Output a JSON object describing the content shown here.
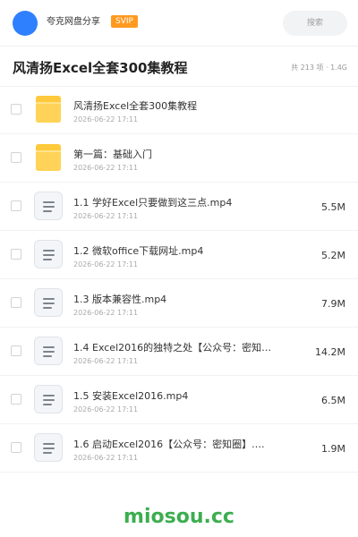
{
  "header": {
    "share_title": "夸克网盘分享",
    "badge": "SVIP",
    "search_placeholder": "搜索"
  },
  "folder": {
    "title": "风清扬Excel全套300集教程",
    "meta": "共 213 项 · 1.4G"
  },
  "colors": {
    "accent_blue": "#2f80ff",
    "svip_orange": "#ff9a1f",
    "folder_yellow": "#ffc93c",
    "watermark_green": "#3cae50"
  },
  "items": [
    {
      "type": "folder",
      "icon": "folder-icon",
      "name": "风清扬Excel全套300集教程",
      "date": "2026-06-22 17:11",
      "size": ""
    },
    {
      "type": "folder",
      "icon": "folder-icon",
      "name": "第一篇：基础入门",
      "date": "2026-06-22 17:11",
      "size": ""
    },
    {
      "type": "file",
      "icon": "document-icon",
      "name": "1.1 学好Excel只要做到这三点.mp4",
      "date": "2026-06-22 17:11",
      "size": "5.5M"
    },
    {
      "type": "file",
      "icon": "document-icon",
      "name": "1.2 微软office下载网址.mp4",
      "date": "2026-06-22 17:11",
      "size": "5.2M"
    },
    {
      "type": "file",
      "icon": "document-icon",
      "name": "1.3 版本兼容性.mp4",
      "date": "2026-06-22 17:11",
      "size": "7.9M"
    },
    {
      "type": "file",
      "icon": "document-icon",
      "name": "1.4 Excel2016的独特之处【公众号：密知…",
      "date": "2026-06-22 17:11",
      "size": "14.2M"
    },
    {
      "type": "file",
      "icon": "document-icon",
      "name": "1.5 安装Excel2016.mp4",
      "date": "2026-06-22 17:11",
      "size": "6.5M"
    },
    {
      "type": "file",
      "icon": "document-icon",
      "name": "1.6 启动Excel2016【公众号：密知圈】.…",
      "date": "2026-06-22 17:11",
      "size": "1.9M"
    }
  ],
  "watermark": "miosou.cc"
}
